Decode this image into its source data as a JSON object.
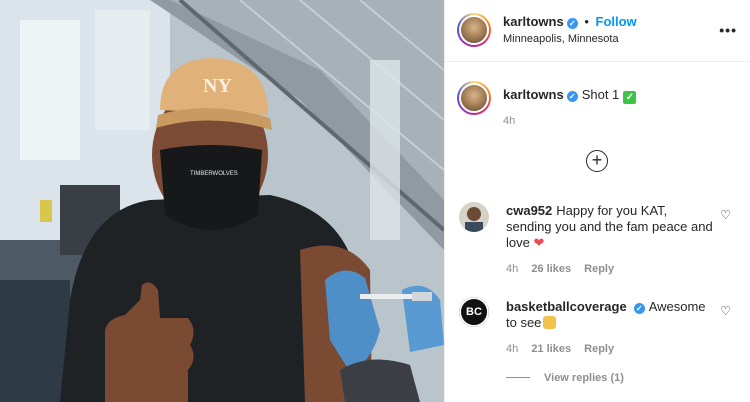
{
  "post_header": {
    "username": "karltowns",
    "separator": "•",
    "follow_label": "Follow",
    "location": "Minneapolis, Minnesota",
    "more_icon": "more-options-icon",
    "more_glyph": "•••"
  },
  "caption": {
    "username": "karltowns",
    "text": "Shot 1",
    "emoji": "✓",
    "time": "4h"
  },
  "load_more_glyph": "+",
  "comments": [
    {
      "username": "cwa952",
      "text": "Happy for you KAT, sending you and the fam peace and love",
      "emoji": "❤",
      "time": "4h",
      "likes": "26 likes",
      "reply_label": "Reply"
    },
    {
      "username": "basketballcoverage",
      "text": "Awesome to see",
      "time": "4h",
      "likes": "21 likes",
      "reply_label": "Reply",
      "avatar_text": "BC"
    }
  ],
  "view_replies": "View replies (1)",
  "verified_glyph": "✓",
  "like_glyph": "♡",
  "colors": {
    "link_blue": "#0095f6",
    "verified_blue": "#3897f0",
    "muted_gray": "#8e8e8e"
  }
}
